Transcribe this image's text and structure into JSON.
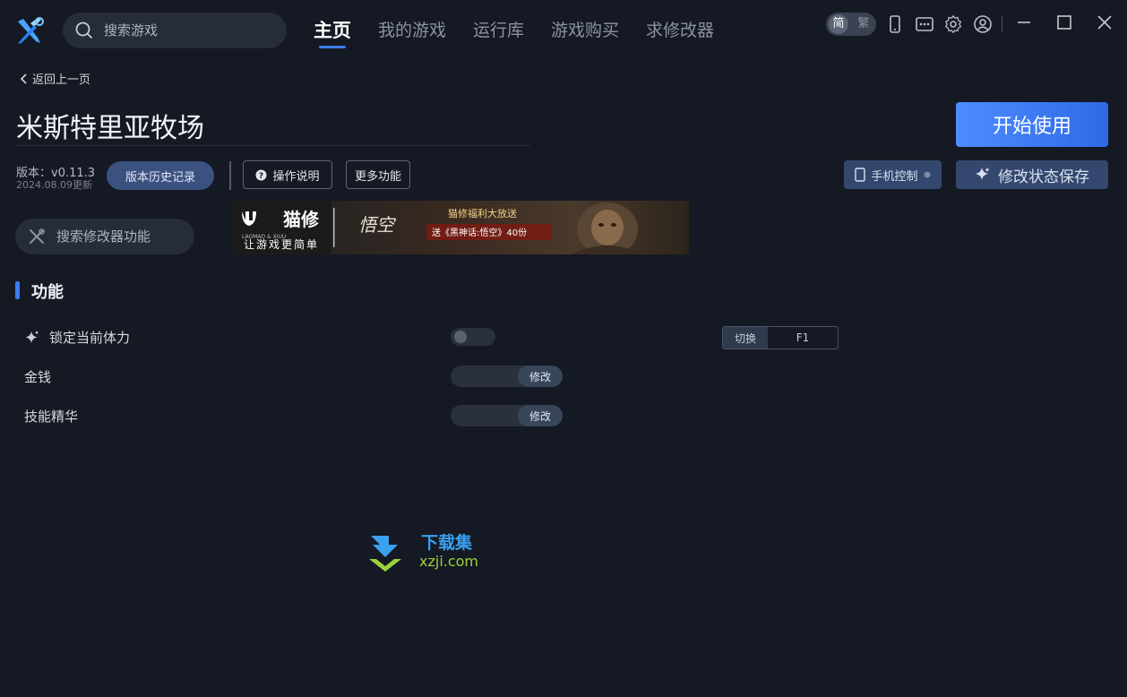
{
  "topbar": {
    "search_placeholder": "搜索游戏",
    "nav": [
      "主页",
      "我的游戏",
      "运行库",
      "游戏购买",
      "求修改器"
    ],
    "active_nav": 0,
    "lang": {
      "simplified": "简",
      "traditional": "繁"
    }
  },
  "header": {
    "back_label": "返回上一页",
    "game_title": "米斯特里亚牧场",
    "start_button": "开始使用",
    "version": "版本：v0.11.3",
    "version_date": "2024.08.09更新",
    "history_button": "版本历史记录",
    "instructions_button": "操作说明",
    "more_button": "更多功能",
    "phone_button": "手机控制",
    "save_button": "修改状态保存"
  },
  "function_search_placeholder": "搜索修改器功能",
  "banner": {
    "brand": "猫修",
    "slogan": "让游戏更简单",
    "brand_small": "LAOMAO & XIUU",
    "game_logo": "悟空",
    "promo_line1": "猫修福利大放送",
    "promo_line2": "送《黑神话:悟空》40份"
  },
  "section_title": "功能",
  "features": [
    {
      "label": "锁定当前体力",
      "type": "toggle",
      "enabled": false,
      "hotkey_label": "切换",
      "hotkey": "F1"
    },
    {
      "label": "金钱",
      "type": "modify",
      "value": "",
      "button": "修改"
    },
    {
      "label": "技能精华",
      "type": "modify",
      "value": "",
      "button": "修改"
    }
  ],
  "watermark": {
    "title": "下载集",
    "site": "xzji.com"
  },
  "colors": {
    "accent": "#3d7cf0",
    "background": "#141923",
    "panel": "#262c38"
  }
}
